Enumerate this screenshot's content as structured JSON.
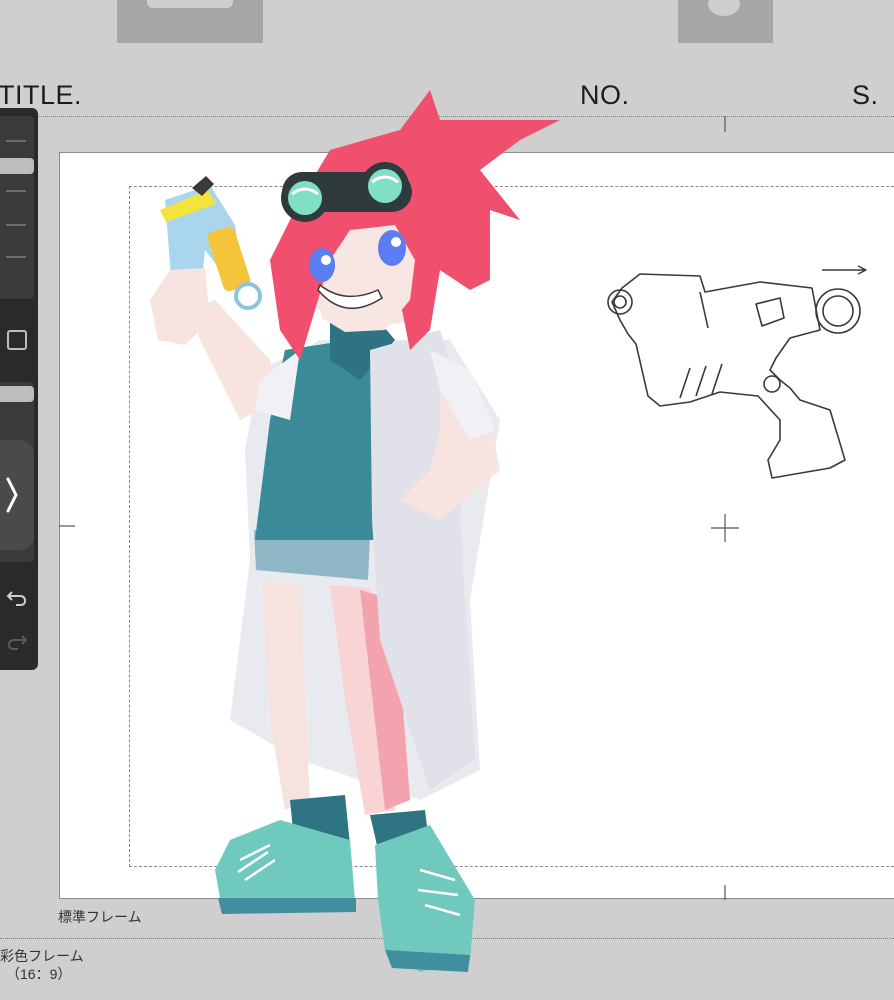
{
  "header": {
    "title_label": "TITLE.",
    "number_label": "NO.",
    "scene_label": "S."
  },
  "frames": {
    "standard_frame_label": "標準フレーム",
    "color_frame_label": "彩色フレーム",
    "color_frame_ratio": "（16：9）"
  },
  "toolbar": {
    "brush_size_icon": "brush-size-slider",
    "color_icon": "square-icon",
    "opacity_icon": "opacity-slider",
    "expand_icon": "chevron-right-icon",
    "undo_icon": "undo-icon",
    "redo_icon": "redo-icon"
  },
  "colors": {
    "background": "#cfcfcf",
    "paper": "#ffffff",
    "toolbar": "#2a2a2a",
    "hair": "#f0506e",
    "coat": "#e9eaf0",
    "shirt": "#3a8a9a",
    "shoes": "#6fc9bd",
    "goggle_lens": "#7fe0c4"
  }
}
